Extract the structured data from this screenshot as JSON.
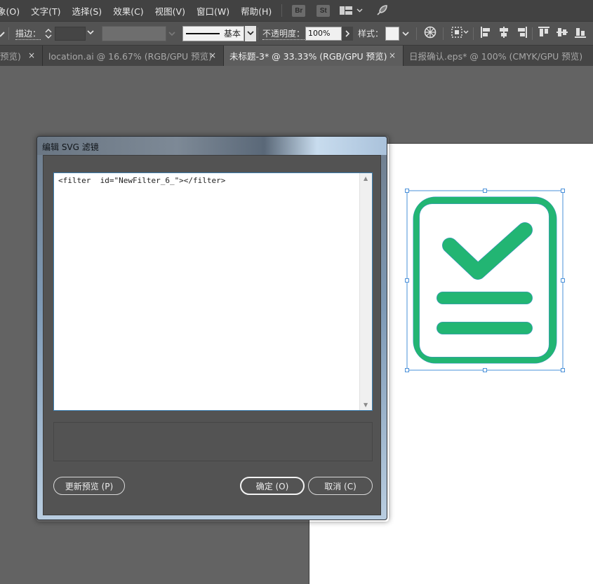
{
  "menu": {
    "items": [
      "象(O)",
      "文字(T)",
      "选择(S)",
      "效果(C)",
      "视图(V)",
      "窗口(W)",
      "帮助(H)"
    ],
    "badges": {
      "bridge": "Br",
      "stock": "St"
    },
    "icons": [
      "workspace-icon",
      "chevron-down-icon",
      "rocket-icon"
    ]
  },
  "control": {
    "stroke_label": "描边：",
    "brush_label": "基本",
    "opacity_label": "不透明度：",
    "opacity_value": "100%",
    "style_label": "样式："
  },
  "tabs": [
    {
      "label": "预览)",
      "active": false
    },
    {
      "label": "location.ai @ 16.67% (RGB/GPU 预览)",
      "active": false
    },
    {
      "label": "未标题-3* @ 33.33% (RGB/GPU 预览)",
      "active": true
    },
    {
      "label": "日报确认.eps* @ 100% (CMYK/GPU 预览)",
      "active": false
    }
  ],
  "tab_close_glyph": "×",
  "dialog": {
    "title": "编辑 SVG 滤镜",
    "filter_code": "<filter  id=\"NewFilter_6_\"></filter>",
    "update_preview": "更新预览 (P)",
    "ok": "确定 (O)",
    "cancel": "取消 (C)"
  },
  "colors": {
    "icon_green": "#22b573",
    "selection_blue": "#4a90d9",
    "menu_bg": "#424242",
    "panel_bg": "#535353",
    "canvas_bg": "#636363"
  }
}
